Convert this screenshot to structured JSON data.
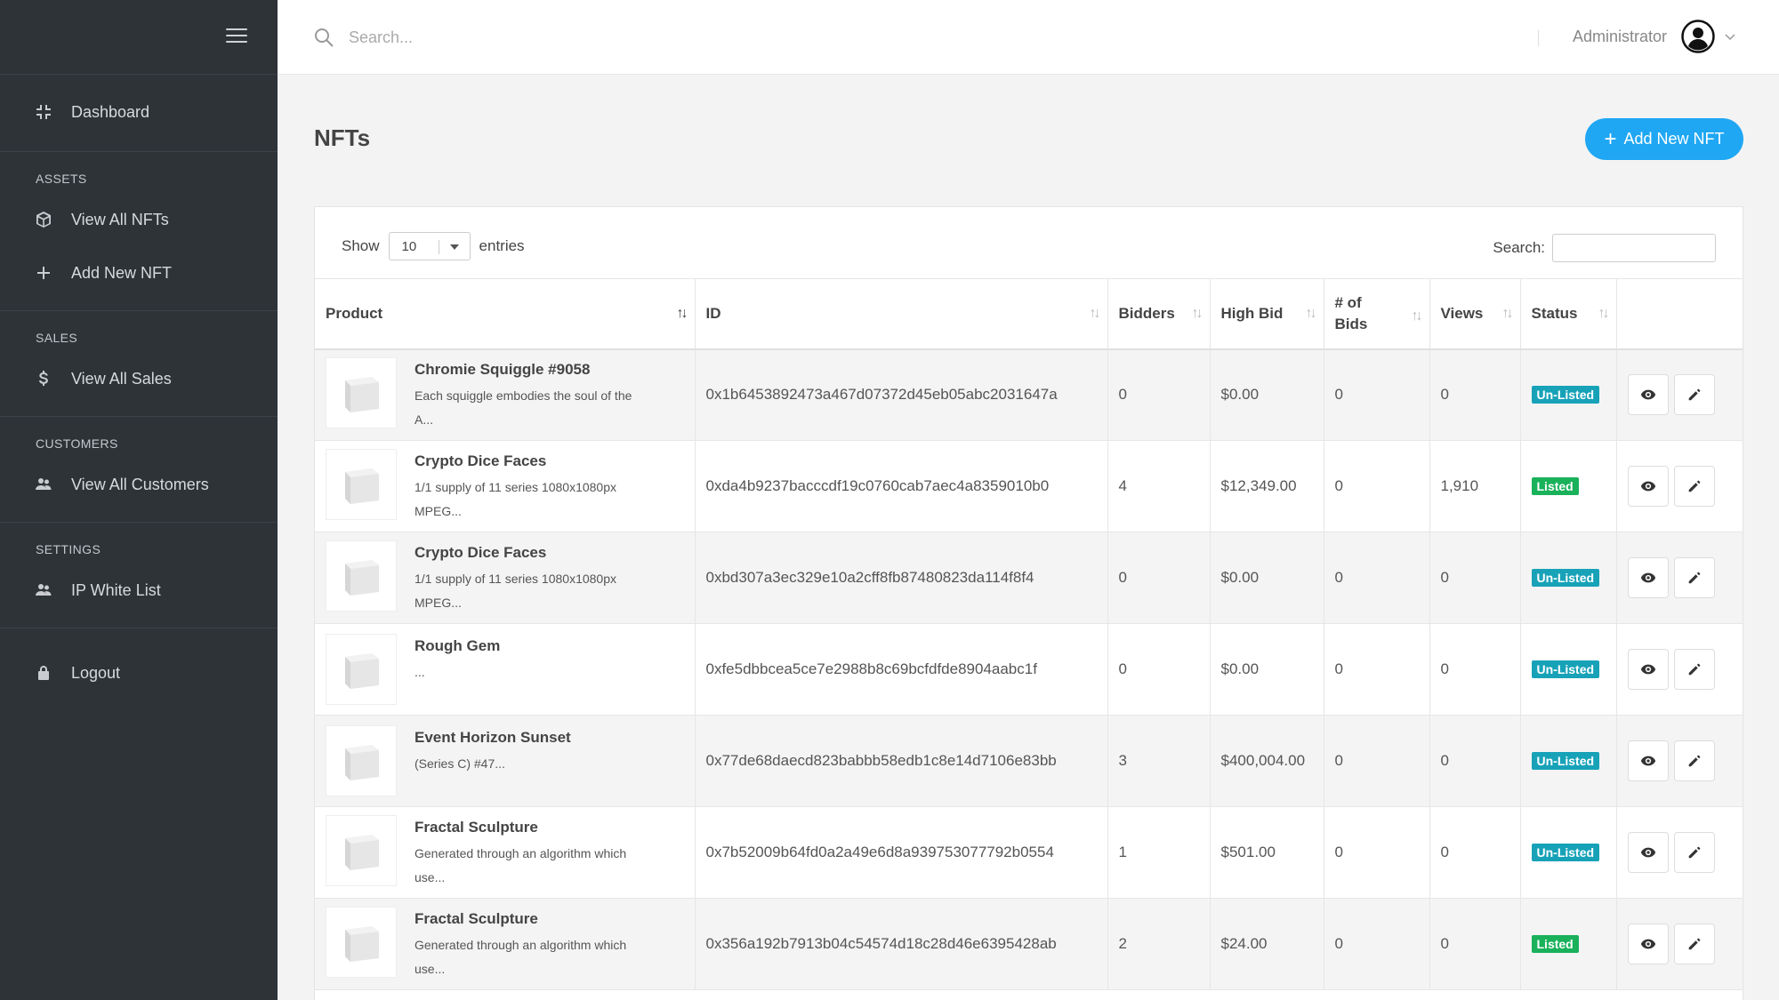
{
  "sidebar": {
    "dashboard": "Dashboard",
    "sections": [
      {
        "heading": "ASSETS",
        "items": [
          {
            "label": "View All NFTs",
            "icon": "cube-icon"
          },
          {
            "label": "Add New NFT",
            "icon": "plus-icon"
          }
        ]
      },
      {
        "heading": "SALES",
        "items": [
          {
            "label": "View All Sales",
            "icon": "dollar-icon"
          }
        ]
      },
      {
        "heading": "CUSTOMERS",
        "items": [
          {
            "label": "View All Customers",
            "icon": "users-icon"
          }
        ]
      },
      {
        "heading": "SETTINGS",
        "items": [
          {
            "label": "IP White List",
            "icon": "users-icon"
          }
        ]
      }
    ],
    "logout": "Logout"
  },
  "topbar": {
    "search_placeholder": "Search...",
    "user_name": "Administrator"
  },
  "page": {
    "title": "NFTs",
    "add_button": "Add New NFT"
  },
  "table_controls": {
    "show_label": "Show",
    "entries_value": "10",
    "entries_label": "entries",
    "search_label": "Search:"
  },
  "table": {
    "columns": [
      "Product",
      "ID",
      "Bidders",
      "High Bid",
      "# of Bids",
      "Views",
      "Status"
    ],
    "rows": [
      {
        "name": "Chromie Squiggle #9058",
        "desc1": "Each squiggle embodies the soul of the",
        "desc2": "A...",
        "id": "0x1b6453892473a467d07372d45eb05abc2031647a",
        "bidders": "0",
        "high_bid": "$0.00",
        "bids": "0",
        "views": "0",
        "status": "Un-Listed"
      },
      {
        "name": "Crypto Dice Faces",
        "desc1": "1/1 supply of 11 series 1080x1080px",
        "desc2": "MPEG...",
        "id": "0xda4b9237bacccdf19c0760cab7aec4a8359010b0",
        "bidders": "4",
        "high_bid": "$12,349.00",
        "bids": "0",
        "views": "1,910",
        "status": "Listed"
      },
      {
        "name": "Crypto Dice Faces",
        "desc1": "1/1 supply of 11 series 1080x1080px",
        "desc2": "MPEG...",
        "id": "0xbd307a3ec329e10a2cff8fb87480823da114f8f4",
        "bidders": "0",
        "high_bid": "$0.00",
        "bids": "0",
        "views": "0",
        "status": "Un-Listed"
      },
      {
        "name": "Rough Gem",
        "desc1": "...",
        "desc2": "",
        "id": "0xfe5dbbcea5ce7e2988b8c69bcfdfde8904aabc1f",
        "bidders": "0",
        "high_bid": "$0.00",
        "bids": "0",
        "views": "0",
        "status": "Un-Listed"
      },
      {
        "name": "Event Horizon Sunset",
        "desc1": "(Series C) #47...",
        "desc2": "",
        "id": "0x77de68daecd823babbb58edb1c8e14d7106e83bb",
        "bidders": "3",
        "high_bid": "$400,004.00",
        "bids": "0",
        "views": "0",
        "status": "Un-Listed"
      },
      {
        "name": "Fractal Sculpture",
        "desc1": "Generated through an algorithm which",
        "desc2": "use...",
        "id": "0x7b52009b64fd0a2a49e6d8a939753077792b0554",
        "bidders": "1",
        "high_bid": "$501.00",
        "bids": "0",
        "views": "0",
        "status": "Un-Listed"
      },
      {
        "name": "Fractal Sculpture",
        "desc1": "Generated through an algorithm which",
        "desc2": "use...",
        "id": "0x356a192b7913b04c54574d18c28d46e6395428ab",
        "bidders": "2",
        "high_bid": "$24.00",
        "bids": "0",
        "views": "0",
        "status": "Listed"
      }
    ]
  },
  "colors": {
    "sidebar_bg": "#2e3338",
    "accent": "#1fa7f4",
    "unlisted": "#17a2b8",
    "listed": "#19b15a"
  }
}
